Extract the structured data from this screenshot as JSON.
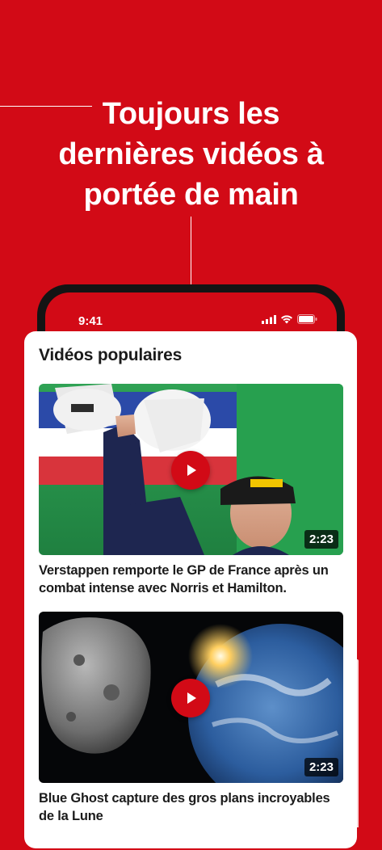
{
  "headline": {
    "line1": "Toujours les",
    "line2": "dernières vidéos à",
    "line3": "portée de main"
  },
  "status_bar": {
    "time": "9:41",
    "icons": [
      "signal-icon",
      "wifi-icon",
      "battery-icon"
    ]
  },
  "section": {
    "title": "Vidéos populaires"
  },
  "videos": [
    {
      "duration": "2:23",
      "title": "Verstappen remporte le GP de France après un combat intense avec Norris et Hamilton."
    },
    {
      "duration": "2:23",
      "title": "Blue Ghost capture des gros plans incroyables de la Lune"
    }
  ],
  "colors": {
    "brand_red": "#d20a16",
    "card_bg": "#ffffff",
    "phone_frame": "#141414"
  }
}
